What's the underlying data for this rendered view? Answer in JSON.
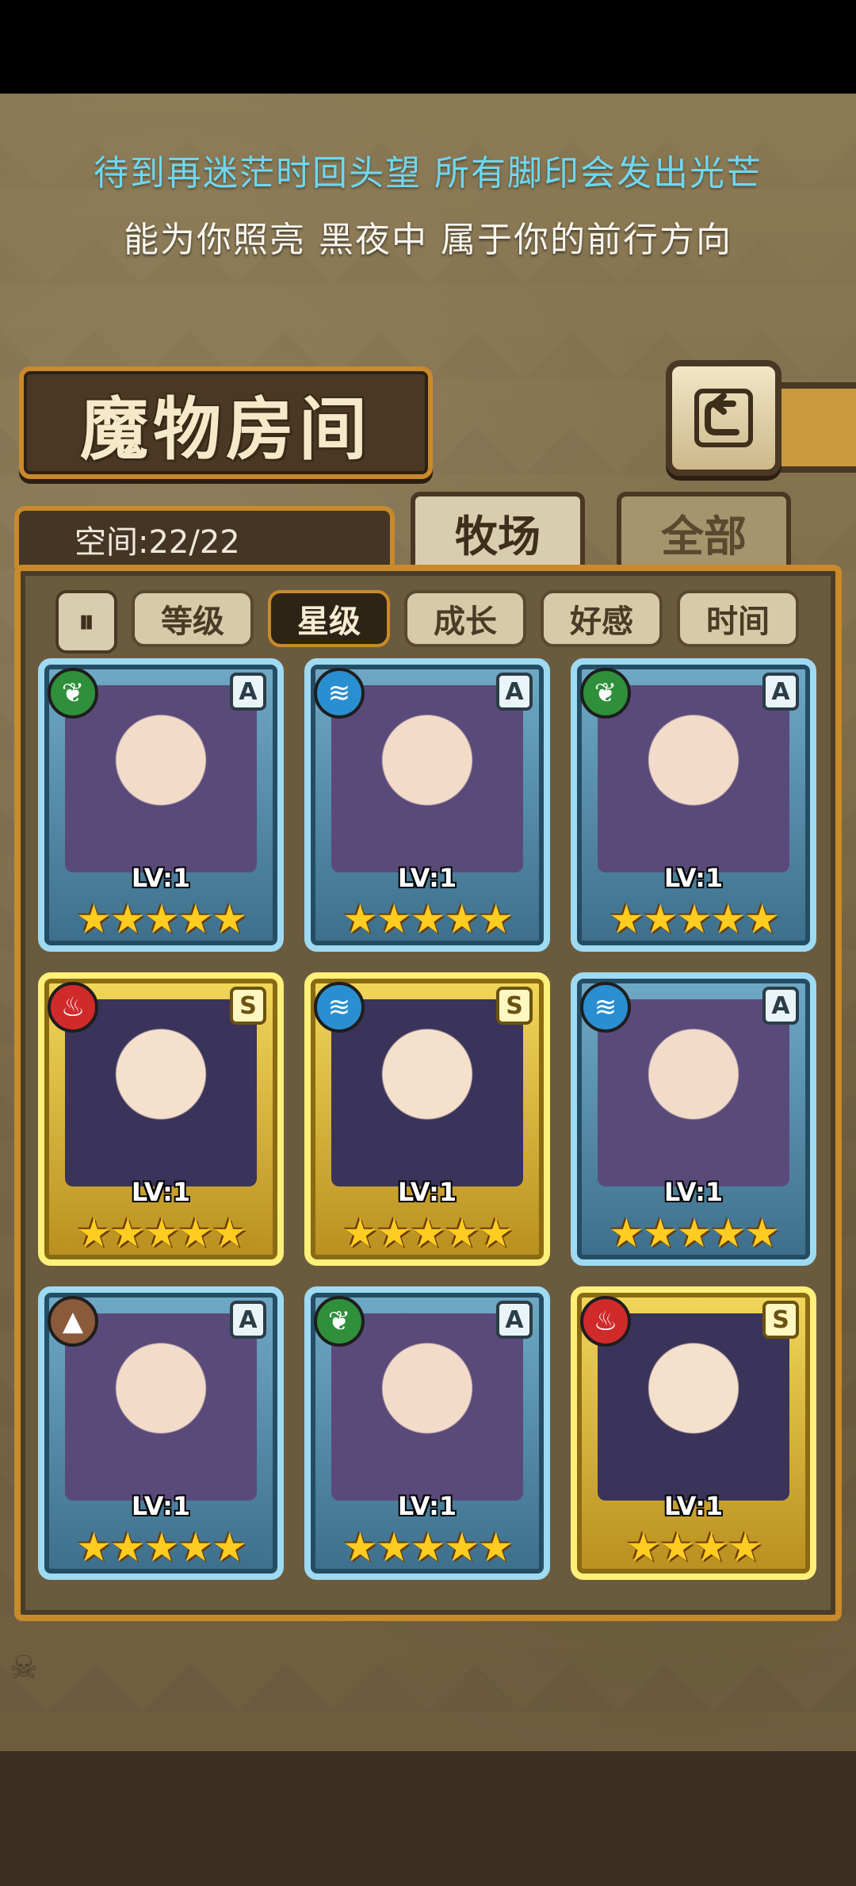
{
  "lyrics": {
    "line1": "待到再迷茫时回头望  所有脚印会发出光芒",
    "line2": "能为你照亮 黑夜中 属于你的前行方向"
  },
  "header": {
    "title": "魔物房间",
    "back_icon": "return-arrow-icon"
  },
  "tabs": {
    "space_label": "空间:22/22",
    "ranch": "牧场",
    "all": "全部"
  },
  "sort": {
    "toggle_icon": "sort-toggle-icon",
    "buttons": [
      "等级",
      "星级",
      "成长",
      "好感",
      "时间"
    ],
    "active": "星级"
  },
  "cards": [
    {
      "element": "leaf",
      "rank": "A",
      "level": "LV:1",
      "stars": "★★★★★"
    },
    {
      "element": "water",
      "rank": "A",
      "level": "LV:1",
      "stars": "★★★★★"
    },
    {
      "element": "leaf",
      "rank": "A",
      "level": "LV:1",
      "stars": "★★★★★"
    },
    {
      "element": "fire",
      "rank": "S",
      "level": "LV:1",
      "stars": "★★★★★"
    },
    {
      "element": "water",
      "rank": "S",
      "level": "LV:1",
      "stars": "★★★★★"
    },
    {
      "element": "water",
      "rank": "A",
      "level": "LV:1",
      "stars": "★★★★★"
    },
    {
      "element": "earth",
      "rank": "A",
      "level": "LV:1",
      "stars": "★★★★★"
    },
    {
      "element": "leaf",
      "rank": "A",
      "level": "LV:1",
      "stars": "★★★★★"
    },
    {
      "element": "fire",
      "rank": "S",
      "level": "LV:1",
      "stars": "★★★★"
    }
  ]
}
